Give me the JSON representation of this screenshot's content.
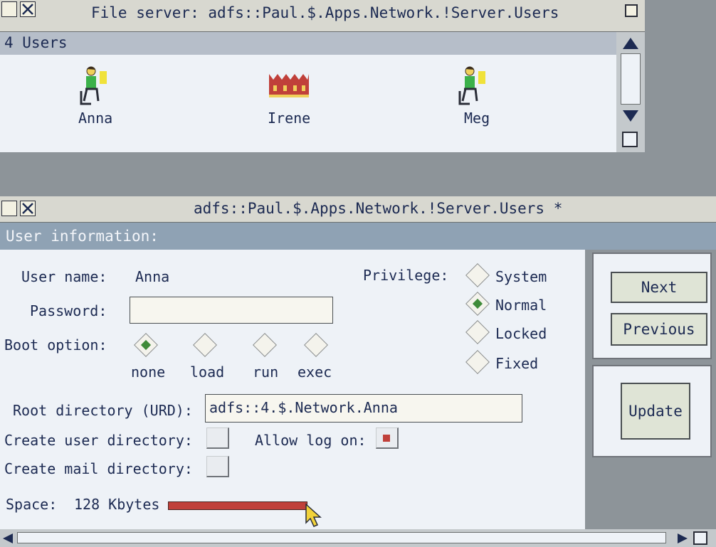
{
  "top_window": {
    "title": "File server: adfs::Paul.$.Apps.Network.!Server.Users",
    "header": "4 Users",
    "users": [
      {
        "name": "Anna",
        "icon": "user-at-desk-icon"
      },
      {
        "name": "Irene",
        "icon": "crown-icon"
      },
      {
        "name": "Meg",
        "icon": "user-at-desk-icon"
      }
    ]
  },
  "dialog": {
    "title": "adfs::Paul.$.Apps.Network.!Server.Users *",
    "header": "User information:",
    "user_name_label": "User name:",
    "user_name_value": "Anna",
    "password_label": "Password:",
    "password_value": "",
    "boot_option_label": "Boot option:",
    "boot_options": [
      "none",
      "load",
      "run",
      "exec"
    ],
    "boot_selected": "none",
    "privilege_label": "Privilege:",
    "privileges": [
      "System",
      "Normal",
      "Locked",
      "Fixed"
    ],
    "privilege_selected": "Normal",
    "root_dir_label": "Root directory (URD):",
    "root_dir_value": "adfs::4.$.Network.Anna",
    "create_user_dir_label": "Create user directory:",
    "create_user_dir_checked": false,
    "allow_logon_label": "Allow log on:",
    "allow_logon_checked": true,
    "create_mail_dir_label": "Create mail directory:",
    "create_mail_dir_checked": false,
    "space_label": "Space:",
    "space_value": "128 Kbytes",
    "buttons": {
      "next": "Next",
      "previous": "Previous",
      "update": "Update"
    }
  },
  "colors": {
    "title_bar": "#d8d8d0",
    "header_bar": "#b6bec9",
    "window_bg": "#eef2f7",
    "desktop": "#8d9499",
    "accent_red": "#c0403a",
    "radio_green": "#3f8b3a"
  }
}
